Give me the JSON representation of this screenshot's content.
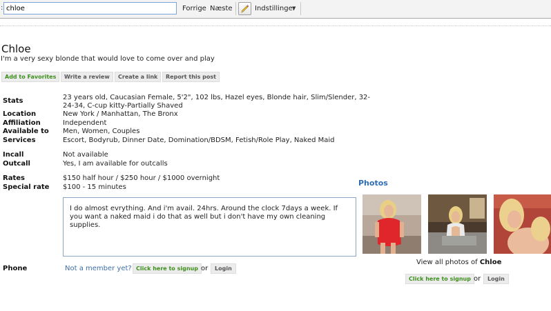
{
  "findbar": {
    "colon": ":",
    "query": "chloe",
    "prev_label": "Forrige",
    "next_label": "Næste",
    "settings_label": "Indstillinger",
    "settings_caret": "▼"
  },
  "profile": {
    "name": "Chloe",
    "tagline": "I'm a very sexy blonde that would love to come over and play",
    "actions": {
      "favorites": "Add to Favorites",
      "review": "Write a review",
      "link": "Create a link",
      "report": "Report this post"
    },
    "details": {
      "stats_label": "Stats",
      "stats_line1": "23 years old, Caucasian Female, 5'2\", 102 lbs, Hazel eyes, Blonde hair, Slim/Slender, 32-",
      "stats_line2": "24-34, C-cup kitty-Partially Shaved",
      "location_label": "Location",
      "location_value": "New York / Manhattan, The Bronx",
      "affiliation_label": "Affiliation",
      "affiliation_value": "Independent",
      "available_label": "Available to",
      "available_value": "Men, Women, Couples",
      "services_label": "Services",
      "services_value": "Escort, Bodyrub, Dinner Date, Domination/BDSM, Fetish/Role Play, Naked Maid",
      "incall_label": "Incall",
      "incall_value": "Not available",
      "outcall_label": "Outcall",
      "outcall_value": "Yes, I am available for outcalls",
      "rates_label": "Rates",
      "rates_value": "$150 half hour / $250 hour / $1000 overnight",
      "special_label": "Special rate",
      "special_value": "$100 - 15 minutes"
    },
    "description": "I do almost evrything. And i'm avail. 24hrs. Around the clock 7days a week. If you want a naked maid i do that as well but i don't have my own cleaning supplies.",
    "phone": {
      "label": "Phone",
      "not_member": "Not a member yet?",
      "signup": "Click here to signup",
      "or": "or",
      "login": "Login"
    }
  },
  "photos": {
    "title": "Photos",
    "view_all_prefix": "View all photos of",
    "view_all_name": "Chloe",
    "signup": "Click here to signup",
    "or": "or",
    "login": "Login"
  }
}
